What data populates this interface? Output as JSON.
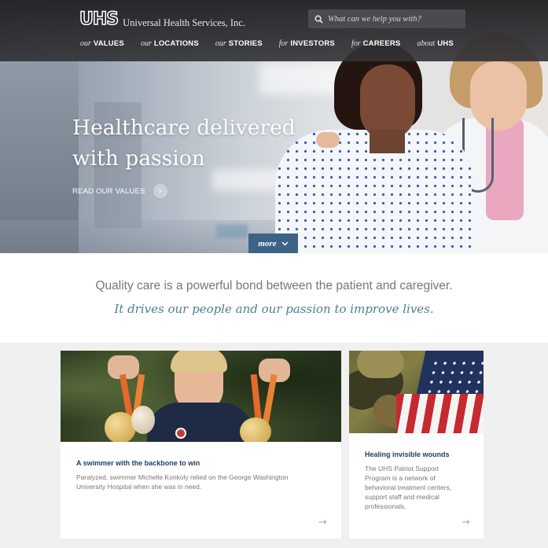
{
  "header": {
    "logo_mark": "UHS",
    "logo_text": "Universal Health Services, Inc.",
    "search_placeholder": "What can we help you with?",
    "nav": [
      {
        "prefix": "our",
        "label": "VALUES"
      },
      {
        "prefix": "our",
        "label": "LOCATIONS"
      },
      {
        "prefix": "our",
        "label": "STORIES"
      },
      {
        "prefix": "for",
        "label": "INVESTORS"
      },
      {
        "prefix": "for",
        "label": "CAREERS"
      },
      {
        "prefix": "about",
        "label": "UHS"
      }
    ]
  },
  "hero": {
    "title_line1": "Healthcare delivered",
    "title_line2": "with passion",
    "cta_label": "READ OUR VALUES",
    "more_label": "more"
  },
  "tagline": {
    "line1": "Quality care is a powerful bond between the patient and caregiver.",
    "line2": "It drives our people and our passion to improve lives."
  },
  "cards": [
    {
      "title": "A swimmer with the backbone to win",
      "body_line1": "Paralyzed, swimmer Michelle Konkoly relied on the George Washington",
      "body_line2": "University Hospital when she was in need."
    },
    {
      "title": "Healing invisible wounds",
      "body_lines": [
        "The UHS Patriot Support",
        "Program is a network of",
        "behavioral treatment centers,",
        "support staff and medical",
        "professionals."
      ]
    }
  ],
  "colors": {
    "header_bg": "#2a2a2e",
    "more_tab": "#3d6487",
    "tagline_italic": "#4d7f91",
    "card_title": "#1f4060"
  },
  "icons": [
    "search-icon",
    "chevron-right-icon",
    "chevron-down-icon",
    "arrow-right-icon"
  ]
}
